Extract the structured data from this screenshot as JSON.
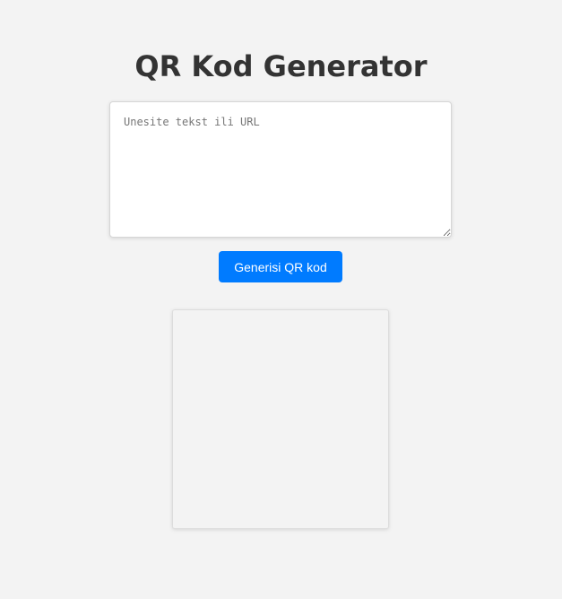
{
  "header": {
    "title": "QR Kod Generator"
  },
  "input": {
    "placeholder": "Unesite tekst ili URL",
    "value": ""
  },
  "actions": {
    "generate_label": "Generisi QR kod"
  },
  "colors": {
    "background": "#f3f3f3",
    "accent": "#007bff",
    "title_text": "#333333"
  }
}
